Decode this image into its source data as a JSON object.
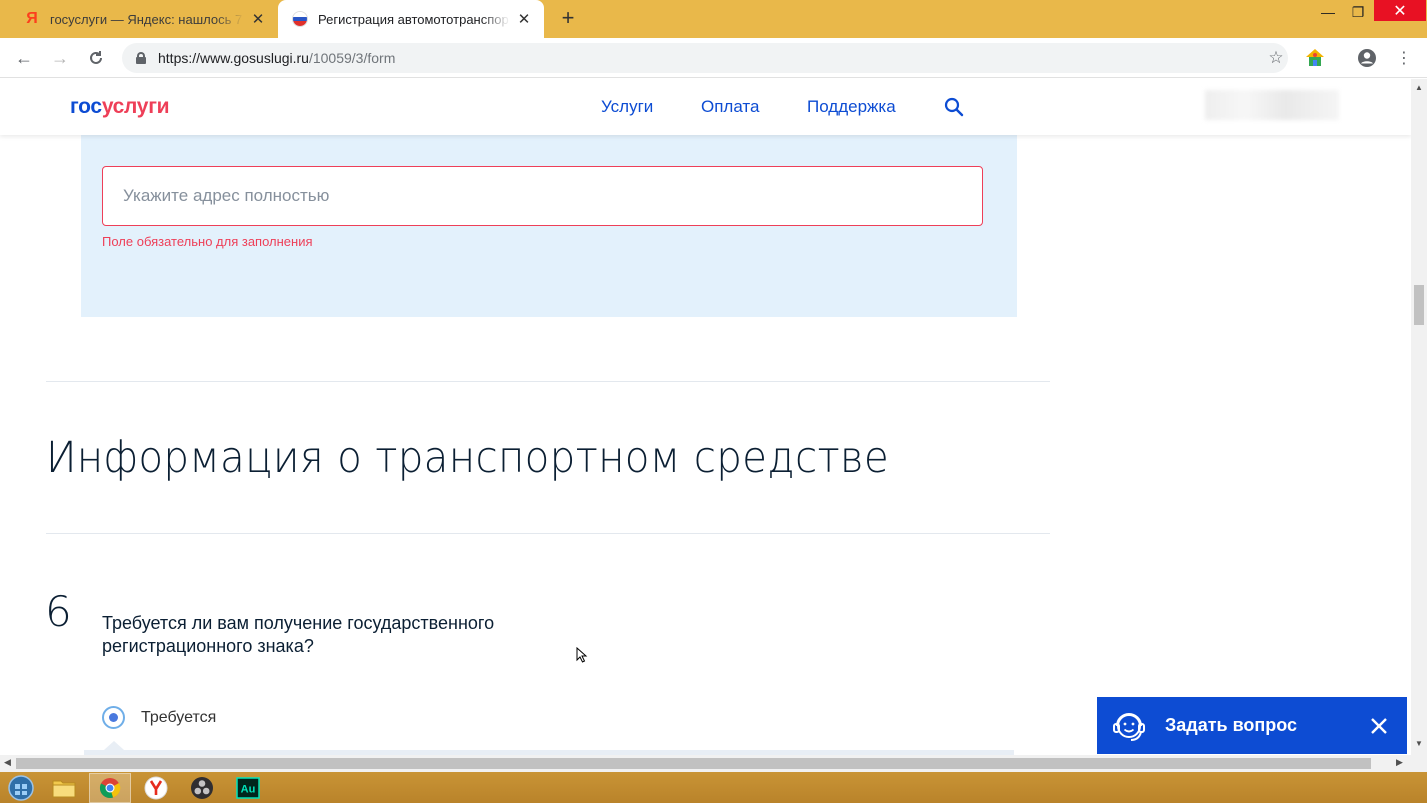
{
  "browser": {
    "tabs": [
      {
        "title": "госуслуги — Яндекс: нашлось 7",
        "favicon": "yandex-icon",
        "active": false
      },
      {
        "title": "Регистрация автомототранспор",
        "favicon": "russia-flag-icon",
        "active": true
      }
    ],
    "url_host": "https://www.gosuslugi.ru",
    "url_path": "/10059/3/form"
  },
  "site": {
    "logo_part1": "гос",
    "logo_part2": "услуги",
    "nav": [
      "Услуги",
      "Оплата",
      "Поддержка"
    ]
  },
  "form": {
    "address_placeholder": "Укажите адрес полностью",
    "address_value": "",
    "address_error": "Поле обязательно для заполнения",
    "section_title": "Информация о транспортном средстве",
    "question_number": "6",
    "question_text": "Требуется ли вам получение государственного регистрационного знака?",
    "option_selected": "Требуется"
  },
  "chat": {
    "label": "Задать вопрос"
  },
  "taskbar": {
    "apps": [
      "start-icon",
      "file-explorer-icon",
      "chrome-icon",
      "yandex-browser-icon",
      "obs-icon",
      "audition-icon"
    ]
  },
  "colors": {
    "brand_blue": "#0d4cd3",
    "brand_red": "#ee3f58",
    "panel_bg": "#e3f1fc",
    "tabstrip": "#e9b84a"
  }
}
